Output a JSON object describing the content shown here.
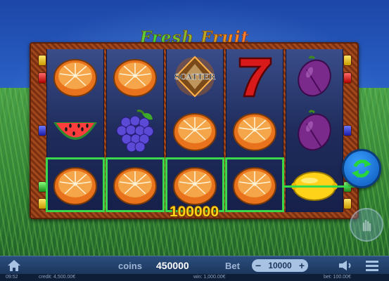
{
  "game": {
    "title": "Fresh Fruit",
    "win_amount": "100000",
    "reels": [
      [
        "orange",
        "watermelon",
        "orange"
      ],
      [
        "orange",
        "grapes",
        "orange"
      ],
      [
        "scatter",
        "orange",
        "orange"
      ],
      [
        "seven",
        "orange",
        "orange"
      ],
      [
        "plum",
        "plum",
        "lemon"
      ]
    ],
    "winning_cells": [
      [
        0,
        2
      ],
      [
        1,
        2
      ],
      [
        2,
        2
      ],
      [
        3,
        2
      ]
    ],
    "scatter_label": "SCATTER"
  },
  "controls": {
    "coins_label": "coins",
    "coins_value": "450000",
    "bet_label": "Bet",
    "bet_value": "10000",
    "bet_minus": "−",
    "bet_plus": "+"
  },
  "status": {
    "time": "09:52",
    "credit": "credit: 4,500.00€",
    "win": "win: 1,000.00€",
    "bet": "bet: 100.00€"
  },
  "icons": {
    "home": "home-icon",
    "spin": "refresh-arrows-icon",
    "sound": "speaker-icon",
    "menu": "hamburger-menu-icon"
  },
  "colors": {
    "win_outline": "#37d84a",
    "win_text": "#ffd21a",
    "spin_button": "#1a78e0"
  }
}
